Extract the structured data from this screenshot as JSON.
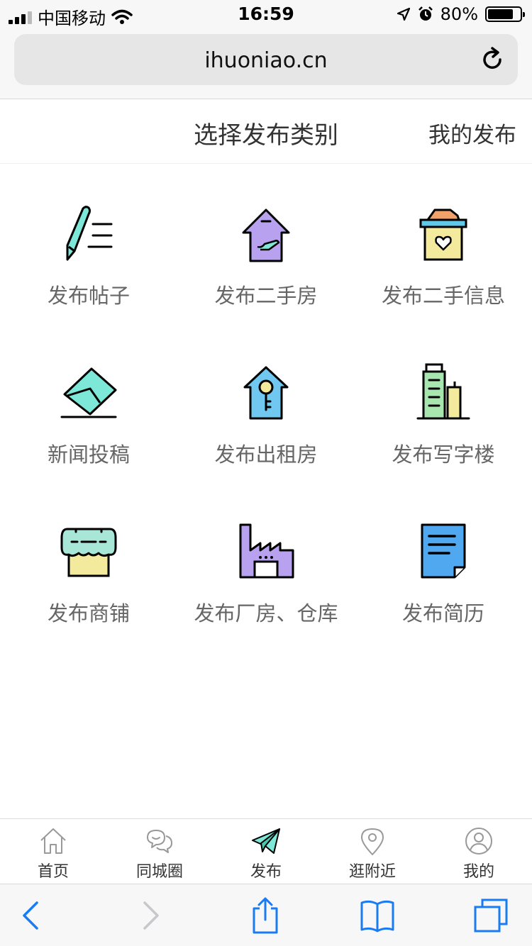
{
  "status_bar": {
    "carrier": "中国移动",
    "time": "16:59",
    "battery_text": "80%",
    "battery_level": 0.8
  },
  "browser": {
    "url": "ihuoniao.cn"
  },
  "header": {
    "title": "选择发布类别",
    "my_posts": "我的发布"
  },
  "categories": [
    {
      "label": "发布帖子",
      "icon": "pencil-icon"
    },
    {
      "label": "发布二手房",
      "icon": "house-hand-icon"
    },
    {
      "label": "发布二手信息",
      "icon": "box-heart-icon"
    },
    {
      "label": "新闻投稿",
      "icon": "envelope-icon"
    },
    {
      "label": "发布出租房",
      "icon": "house-key-icon"
    },
    {
      "label": "发布写字楼",
      "icon": "office-building-icon"
    },
    {
      "label": "发布商铺",
      "icon": "shop-icon"
    },
    {
      "label": "发布厂房、仓库",
      "icon": "factory-icon"
    },
    {
      "label": "发布简历",
      "icon": "resume-icon"
    }
  ],
  "tabs": [
    {
      "label": "首页",
      "icon": "home-icon"
    },
    {
      "label": "同城圈",
      "icon": "chat-icon"
    },
    {
      "label": "发布",
      "icon": "paper-plane-icon"
    },
    {
      "label": "逛附近",
      "icon": "location-icon"
    },
    {
      "label": "我的",
      "icon": "user-icon"
    }
  ],
  "colors": {
    "mint": "#7ee8d8",
    "lavender": "#b8a2f0",
    "yellow": "#f3ea9e",
    "blue": "#50a8f0",
    "toolbar_blue": "#1a7cf5"
  }
}
